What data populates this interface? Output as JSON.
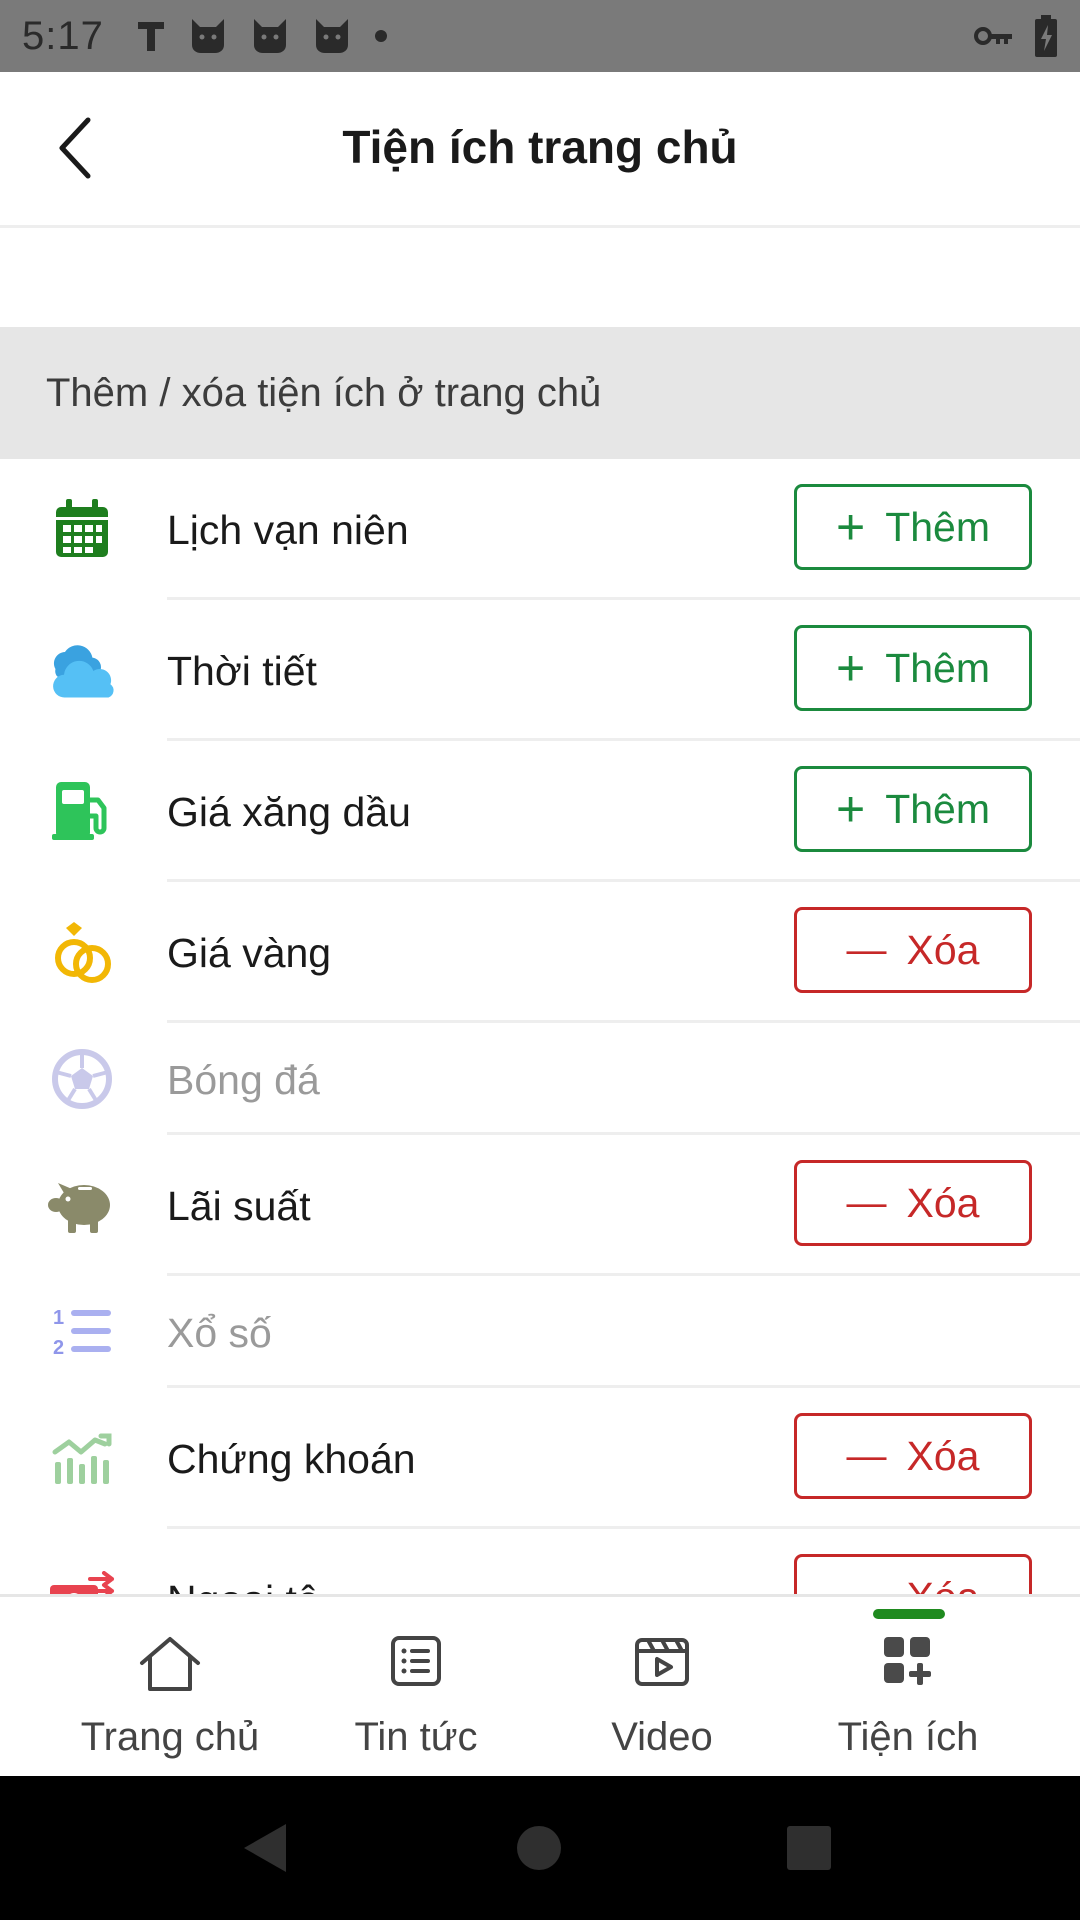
{
  "status_bar": {
    "time": "5:17",
    "icons": [
      "t-icon",
      "cat-icon",
      "cat-icon",
      "cat-icon",
      "dot-icon",
      "key-icon",
      "battery-charging-icon"
    ]
  },
  "header": {
    "title": "Tiện ích trang chủ",
    "back_icon": "back-arrow-icon"
  },
  "section": {
    "title": "Thêm / xóa tiện ích ở trang chủ"
  },
  "buttons": {
    "add_label": "Thêm",
    "add_symbol": "+",
    "remove_label": "Xóa",
    "remove_symbol": "—"
  },
  "widgets": [
    {
      "label": "Lịch vạn niên",
      "icon": "calendar-icon",
      "action": "add",
      "enabled": true
    },
    {
      "label": "Thời tiết",
      "icon": "weather-cloud-icon",
      "action": "add",
      "enabled": true
    },
    {
      "label": "Giá xăng dầu",
      "icon": "fuel-pump-icon",
      "action": "add",
      "enabled": true
    },
    {
      "label": "Giá vàng",
      "icon": "gold-rings-icon",
      "action": "remove",
      "enabled": true
    },
    {
      "label": "Bóng đá",
      "icon": "soccer-ball-icon",
      "action": "none",
      "enabled": false
    },
    {
      "label": "Lãi suất",
      "icon": "piggy-bank-icon",
      "action": "remove",
      "enabled": true
    },
    {
      "label": "Xổ số",
      "icon": "numbered-list-icon",
      "action": "none",
      "enabled": false
    },
    {
      "label": "Chứng khoán",
      "icon": "stock-chart-icon",
      "action": "remove",
      "enabled": true
    },
    {
      "label": "Ngoại tệ",
      "icon": "currency-exchange-icon",
      "action": "remove",
      "enabled": true
    }
  ],
  "bottom_nav": {
    "items": [
      {
        "label": "Trang chủ",
        "icon": "home-icon",
        "active": false
      },
      {
        "label": "Tin tức",
        "icon": "news-list-icon",
        "active": false
      },
      {
        "label": "Video",
        "icon": "video-clapper-icon",
        "active": false
      },
      {
        "label": "Tiện ích",
        "icon": "widgets-add-icon",
        "active": true
      }
    ],
    "active_color": "#1f8a1f"
  },
  "system_nav": [
    "back-triangle-icon",
    "home-circle-icon",
    "recents-square-icon"
  ],
  "colors": {
    "add": "#1b8a3e",
    "remove": "#c62828",
    "section_bg": "#e6e6e6"
  }
}
